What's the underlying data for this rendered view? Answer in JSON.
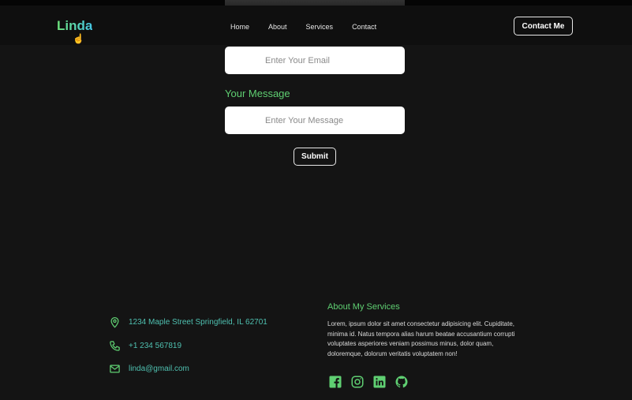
{
  "brand": {
    "logo": "Linda"
  },
  "nav": {
    "links": [
      "Home",
      "About",
      "Services",
      "Contact"
    ],
    "cta_label": "Contact Me"
  },
  "form": {
    "email_placeholder": "Enter Your Email",
    "message_label": "Your Message",
    "message_placeholder": "Enter Your Message",
    "submit_label": "Submit"
  },
  "footer": {
    "contact": {
      "address": "1234 Maple Street Springfield, IL 62701",
      "phone": "+1 234 567819",
      "email": "linda@gmail.com"
    },
    "about": {
      "title": "About My Services",
      "text": "Lorem, ipsum dolor sit amet consectetur adipisicing elit. Cupiditate, minima id. Natus tempora alias harum beatae accusantium corrupti voluptates asperiores veniam possimus minus, dolor quam, doloremque, dolorum veritatis voluptatem non!"
    },
    "socials": [
      "facebook-icon",
      "instagram-icon",
      "linkedin-icon",
      "github-icon"
    ]
  },
  "colors": {
    "background": "#141414",
    "navbar": "#0f0f0f",
    "accent_green": "#5fcf72",
    "accent_teal": "#4fc0b0"
  }
}
